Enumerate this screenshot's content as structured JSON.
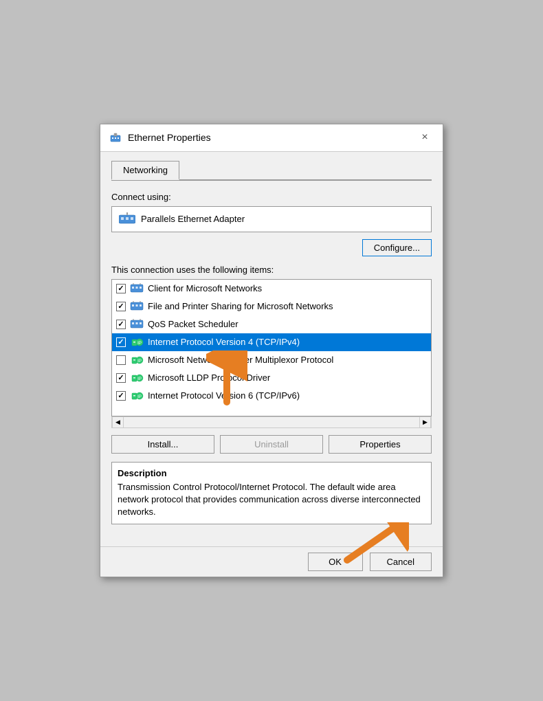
{
  "window": {
    "title": "Ethernet Properties",
    "close_label": "×"
  },
  "tabs": [
    {
      "id": "networking",
      "label": "Networking",
      "active": true
    }
  ],
  "connect_using_label": "Connect using:",
  "adapter": {
    "name": "Parallels Ethernet Adapter"
  },
  "configure_button": "Configure...",
  "items_section_label": "This connection uses the following items:",
  "items": [
    {
      "id": "client-ms-networks",
      "checked": true,
      "label": "Client for Microsoft Networks",
      "icon_type": "network"
    },
    {
      "id": "file-printer-sharing",
      "checked": true,
      "label": "File and Printer Sharing for Microsoft Networks",
      "icon_type": "network"
    },
    {
      "id": "qos-packet-scheduler",
      "checked": true,
      "label": "QoS Packet Scheduler",
      "icon_type": "network"
    },
    {
      "id": "tcp-ipv4",
      "checked": true,
      "label": "Internet Protocol Version 4 (TCP/IPv4)",
      "icon_type": "protocol",
      "selected": true
    },
    {
      "id": "ms-network-adapter",
      "checked": false,
      "label": "Microsoft Network Adapter Multiplexor Protocol",
      "icon_type": "protocol",
      "selected": false
    },
    {
      "id": "ms-lldp",
      "checked": true,
      "label": "Microsoft LLDP Protocol Driver",
      "icon_type": "protocol",
      "selected": false
    },
    {
      "id": "tcp-ipv6",
      "checked": true,
      "label": "Internet Protocol Version 6 (TCP/IPv6)",
      "icon_type": "protocol",
      "selected": false
    }
  ],
  "action_buttons": {
    "install": "Install...",
    "uninstall": "Uninstall",
    "properties": "Properties"
  },
  "description_section": {
    "title": "Description",
    "text": "Transmission Control Protocol/Internet Protocol. The default wide area network protocol that provides communication across diverse interconnected networks."
  },
  "bottom_buttons": {
    "ok": "OK",
    "cancel": "Cancel"
  },
  "colors": {
    "selected_bg": "#0078d7",
    "configure_border": "#0078d7"
  }
}
